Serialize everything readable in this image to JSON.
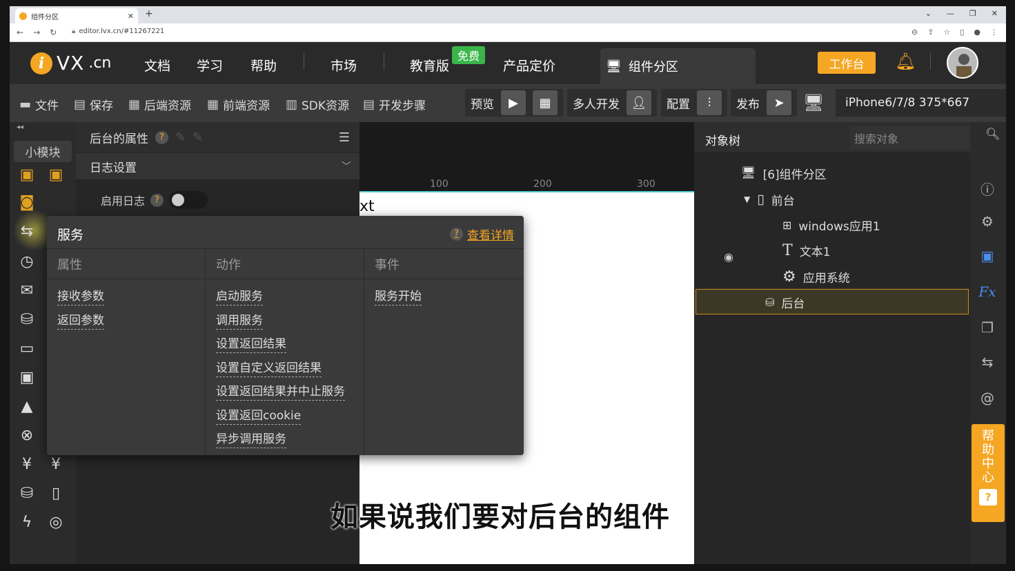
{
  "browser": {
    "tab_title": "组件分区",
    "url": "editor.lvx.cn/#11267221"
  },
  "header": {
    "logo_vx": "VX",
    "logo_cn": ".cn",
    "nav": [
      "文档",
      "学习",
      "帮助",
      "市场",
      "教育版",
      "产品定价"
    ],
    "free_badge": "免费",
    "component_tab": "组件分区",
    "workbench": "工作台"
  },
  "toolbar": {
    "file": "文件",
    "save": "保存",
    "backend_res": "后端资源",
    "frontend_res": "前端资源",
    "sdk_res": "SDK资源",
    "dev_steps": "开发步骤",
    "preview": "预览",
    "multi_dev": "多人开发",
    "config": "配置",
    "publish": "发布",
    "device": "iPhone6/7/8 375*667"
  },
  "left_rail": {
    "small_module": "小模块"
  },
  "properties": {
    "title": "后台的属性",
    "section": "日志设置",
    "enable_log": "启用日志",
    "enable_log_value": false
  },
  "canvas": {
    "ruler": [
      "100",
      "200",
      "300"
    ],
    "caption": "如果说我们要对后台的组件",
    "text_fragment": "xt"
  },
  "popup": {
    "title": "服务",
    "detail_link": "查看详情",
    "columns": [
      {
        "header": "属性",
        "items": [
          "接收参数",
          "返回参数"
        ]
      },
      {
        "header": "动作",
        "items": [
          "启动服务",
          "调用服务",
          "设置返回结果",
          "设置自定义返回结果",
          "设置返回结果并中止服务",
          "设置返回cookie",
          "异步调用服务"
        ]
      },
      {
        "header": "事件",
        "items": [
          "服务开始"
        ]
      }
    ]
  },
  "object_tree": {
    "title": "对象树",
    "search_placeholder": "搜索对象",
    "nodes": {
      "root": "[6]组件分区",
      "frontend": "前台",
      "windows_app": "windows应用1",
      "text1": "文本1",
      "app_system": "应用系统",
      "backend": "后台"
    }
  },
  "help_center": {
    "label": [
      "帮",
      "助",
      "中",
      "心"
    ]
  },
  "colors": {
    "accent": "#f5a623",
    "free_badge": "#3ab54a",
    "selection_border": "#c8901e"
  }
}
